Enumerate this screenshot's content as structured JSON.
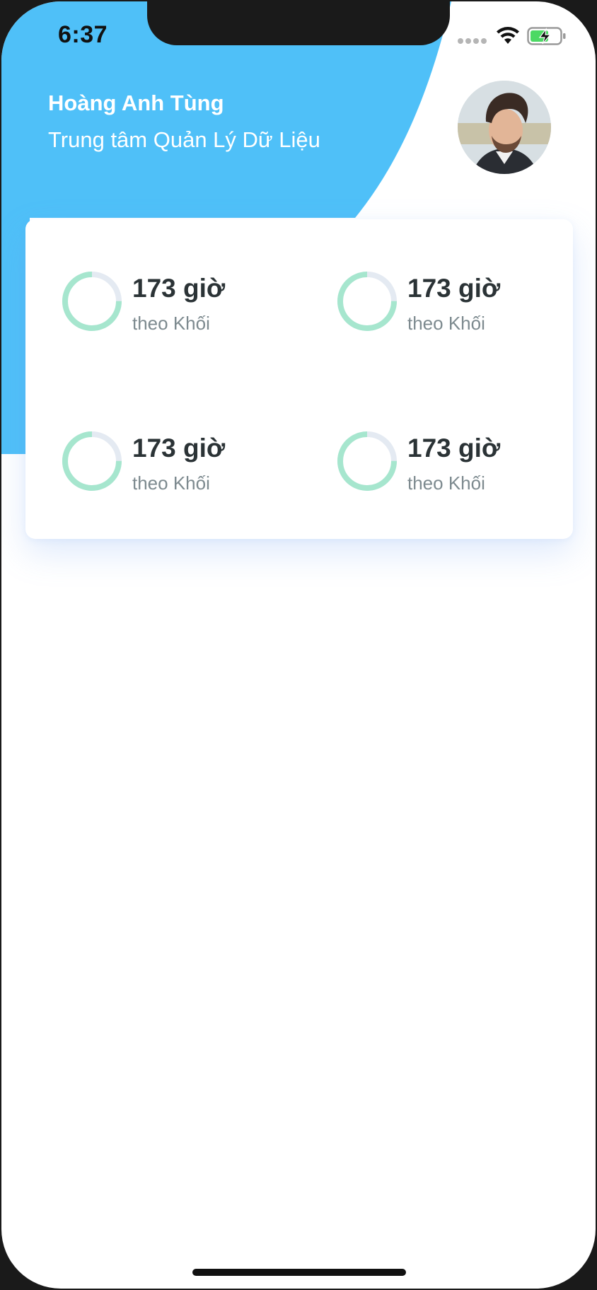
{
  "status_bar": {
    "time": "6:37",
    "signal_icon": "signal-dots-icon",
    "wifi_icon": "wifi-icon",
    "battery_icon": "battery-charging-icon"
  },
  "profile": {
    "name": "Hoàng Anh Tùng",
    "organization": "Trung tâm Quản Lý Dữ Liệu",
    "avatar": "user-avatar-photo"
  },
  "stats": [
    {
      "value": "173 giờ",
      "label": "theo Khối",
      "progress": 0.75
    },
    {
      "value": "173 giờ",
      "label": "theo Khối",
      "progress": 0.75
    },
    {
      "value": "173 giờ",
      "label": "theo Khối",
      "progress": 0.75
    },
    {
      "value": "173 giờ",
      "label": "theo Khối",
      "progress": 0.75
    }
  ],
  "colors": {
    "header_blue": "#4FC0F8",
    "ring_progress": "#A6E6CE",
    "ring_track": "#E4EAF2",
    "value_text": "#2B3336",
    "label_text": "#7D8A8F",
    "battery_green": "#4CD964"
  }
}
